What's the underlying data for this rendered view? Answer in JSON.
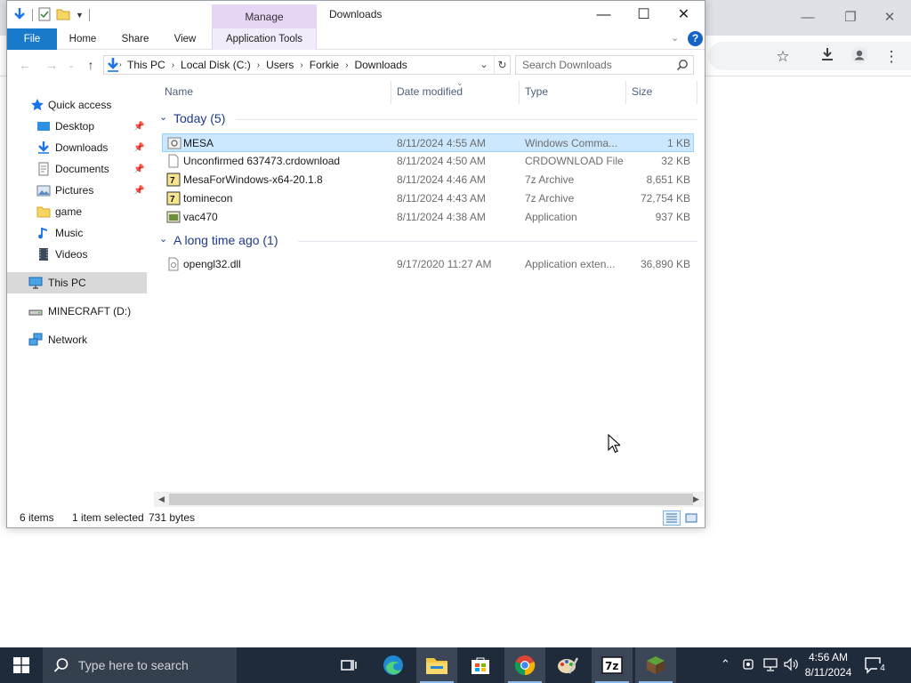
{
  "browser": {
    "toolbar_icons": [
      "star-icon",
      "download-icon",
      "profile-icon",
      "kebab-menu-icon"
    ],
    "window_controls": [
      "minimize",
      "restore",
      "close"
    ]
  },
  "explorer": {
    "title": "Downloads",
    "contextual_tab_group": "Manage",
    "ribbon_tabs": {
      "file": "File",
      "home": "Home",
      "share": "Share",
      "view": "View",
      "app_tools": "Application Tools"
    },
    "help_label": "?",
    "breadcrumb": [
      "This PC",
      "Local Disk (C:)",
      "Users",
      "Forkie",
      "Downloads"
    ],
    "search_placeholder": "Search Downloads",
    "nav_pane": {
      "quick_access": "Quick access",
      "desktop": "Desktop",
      "downloads": "Downloads",
      "documents": "Documents",
      "pictures": "Pictures",
      "game": "game",
      "music": "Music",
      "videos": "Videos",
      "this_pc": "This PC",
      "minecraft": "MINECRAFT (D:)",
      "network": "Network"
    },
    "columns": {
      "name": "Name",
      "date_modified": "Date modified",
      "type": "Type",
      "size": "Size"
    },
    "groups": [
      {
        "label": "Today (5)",
        "files": [
          {
            "name": "MESA",
            "date": "8/11/2024 4:55 AM",
            "type": "Windows Comma...",
            "size": "1 KB",
            "icon": "batch-file-icon",
            "selected": true
          },
          {
            "name": "Unconfirmed 637473.crdownload",
            "date": "8/11/2024 4:50 AM",
            "type": "CRDOWNLOAD File",
            "size": "32 KB",
            "icon": "blank-file-icon",
            "selected": false
          },
          {
            "name": "MesaForWindows-x64-20.1.8",
            "date": "8/11/2024 4:46 AM",
            "type": "7z Archive",
            "size": "8,651 KB",
            "icon": "archive-icon",
            "selected": false
          },
          {
            "name": "tominecon",
            "date": "8/11/2024 4:43 AM",
            "type": "7z Archive",
            "size": "72,754 KB",
            "icon": "archive-icon",
            "selected": false
          },
          {
            "name": "vac470",
            "date": "8/11/2024 4:38 AM",
            "type": "Application",
            "size": "937 KB",
            "icon": "application-icon",
            "selected": false
          }
        ]
      },
      {
        "label": "A long time ago (1)",
        "files": [
          {
            "name": "opengl32.dll",
            "date": "9/17/2020 11:27 AM",
            "type": "Application exten...",
            "size": "36,890 KB",
            "icon": "dll-file-icon",
            "selected": false
          }
        ]
      }
    ],
    "status": {
      "item_count": "6 items",
      "selection": "1 item selected",
      "selection_size": "731 bytes"
    }
  },
  "taskbar": {
    "search_placeholder": "Type here to search",
    "apps": [
      "task-view-icon",
      "edge-icon",
      "file-explorer-icon",
      "store-icon",
      "chrome-icon",
      "paint-icon",
      "7zip-icon",
      "minecraft-icon"
    ],
    "clock_time": "4:56 AM",
    "clock_date": "8/11/2024",
    "notification_count": "4",
    "colors": {
      "accent": "#1979ca",
      "selection": "#cce8ff",
      "taskbar": "#1f2b3a"
    }
  }
}
